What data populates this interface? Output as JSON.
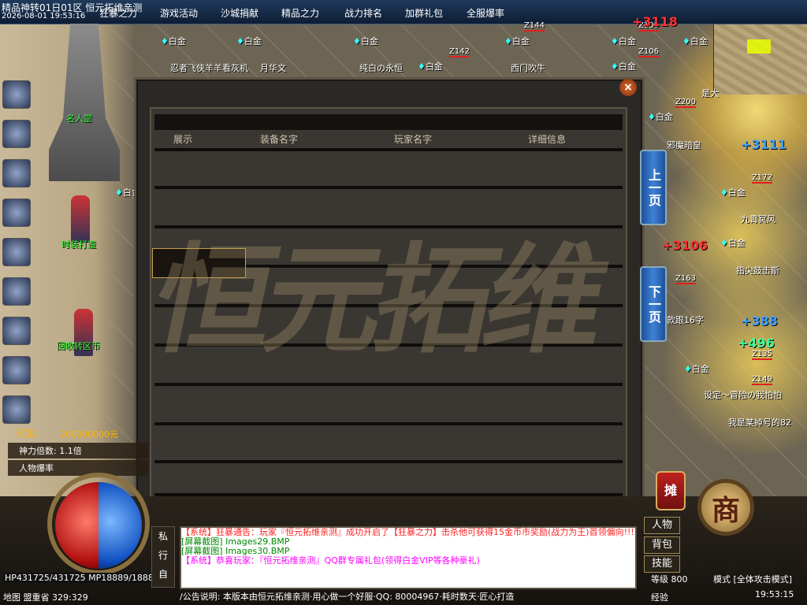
{
  "topbar": {
    "server_title": "精品神转01日01区 恒元拓维亲测",
    "server_date": "2026-08-01 19:53:16",
    "menu": [
      "狂暴之力",
      "游戏活动",
      "沙城捐献",
      "精品之力",
      "战力排名",
      "加群礼包",
      "全服爆率"
    ]
  },
  "world_labels": {
    "statue": "名人堂",
    "npc_forge": "时装打造",
    "npc_return": "回收转区币",
    "names": [
      "忍者飞侠羊羊看灰机",
      "月华文",
      "纯白の永恒",
      "西门吹牛",
      "邪魔暗皇",
      "九霄冥风",
      "指尖鼓击斯",
      "款跟16字",
      "设定～冒险の我怕怕",
      "我是某掉号的82",
      "是大"
    ],
    "tags": [
      "Z100",
      "Z106",
      "Z142",
      "Z144",
      "Z200",
      "Z172",
      "Z163",
      "Z135",
      "Z149"
    ],
    "guild_tag": "白金",
    "damage": [
      "+3118",
      "+3111",
      "+3106",
      "+388",
      "+496"
    ]
  },
  "dialog": {
    "watermark": "恒元拓维",
    "close": "×",
    "columns": [
      "展示",
      "装备名字",
      "玩家名字",
      "详细信息"
    ],
    "prev_page": "上一页",
    "next_page": "下一页"
  },
  "hud": {
    "hp_mp": "HP431725/431725 MP18889/18889",
    "map": "地图 盟重省 329:329",
    "gold_label": "元宝:",
    "gold_value": "200000000元",
    "stat1": "神力倍数: 1.1倍",
    "stat2": "人物爆率",
    "chat_tabs": [
      "私",
      "行",
      "自"
    ],
    "chat": [
      {
        "text": "【系统】狂暴通告：玩家『恒元拓维亲测』成功开启了【狂暴之力】击杀他可获得15金币市奖励(战力为王)首领偏向!!!",
        "color": "#ff2020"
      },
      {
        "text": "[屏幕截图] Images29.BMP",
        "color": "#008800"
      },
      {
        "text": "[屏幕截图] Images30.BMP",
        "color": "#008800"
      },
      {
        "text": "【系统】恭喜玩家：『恒元拓维亲测』QQ群专属礼包(领得白金VIP等各种豪礼)",
        "color": "#ff00ff"
      }
    ],
    "notice": "/公告说明: 本版本由恒元拓维亲测·用心做一个好服·QQ: 80004967·耗时数天·匠心打造",
    "buttons": [
      "人物",
      "背包",
      "技能"
    ],
    "stall": "摊",
    "shop": "商",
    "level": "等级 800",
    "mode": "模式 [全体攻击模式]",
    "exp": "经验",
    "clock": "19:53:15"
  },
  "colors": {
    "accent_blue": "#1d4f9a",
    "dialog_bg": "#3a3732",
    "gold": "#ffb400"
  }
}
